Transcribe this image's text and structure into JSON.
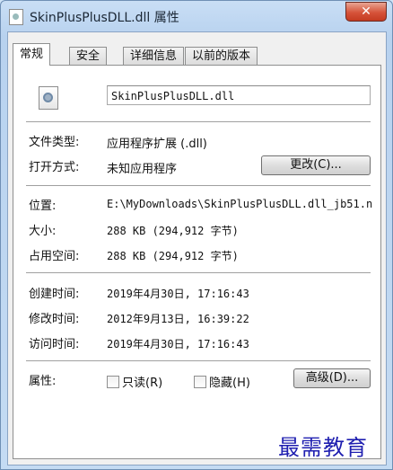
{
  "window": {
    "title": "SkinPlusPlusDLL.dll 属性",
    "close_symbol": "✕"
  },
  "tabs": [
    {
      "label": "常规",
      "active": true
    },
    {
      "label": "安全",
      "active": false
    },
    {
      "label": "详细信息",
      "active": false
    },
    {
      "label": "以前的版本",
      "active": false
    }
  ],
  "general": {
    "filename": "SkinPlusPlusDLL.dll",
    "file_type_label": "文件类型:",
    "file_type_value": "应用程序扩展 (.dll)",
    "opens_with_label": "打开方式:",
    "opens_with_value": "未知应用程序",
    "change_button": "更改(C)...",
    "location_label": "位置:",
    "location_value": "E:\\MyDownloads\\SkinPlusPlusDLL.dll_jb51.n",
    "size_label": "大小:",
    "size_value": "288 KB (294,912 字节)",
    "size_on_disk_label": "占用空间:",
    "size_on_disk_value": "288 KB (294,912 字节)",
    "created_label": "创建时间:",
    "created_value": "2019年4月30日, 17:16:43",
    "modified_label": "修改时间:",
    "modified_value": "2012年9月13日, 16:39:22",
    "accessed_label": "访问时间:",
    "accessed_value": "2019年4月30日, 17:16:43",
    "attributes_label": "属性:",
    "readonly_label": "只读(R)",
    "readonly_checked": false,
    "hidden_label": "隐藏(H)",
    "hidden_checked": false,
    "advanced_button": "高级(D)..."
  },
  "watermark": "最需教育",
  "icons": {
    "title": "dll-file-icon",
    "file": "dll-file-icon"
  }
}
